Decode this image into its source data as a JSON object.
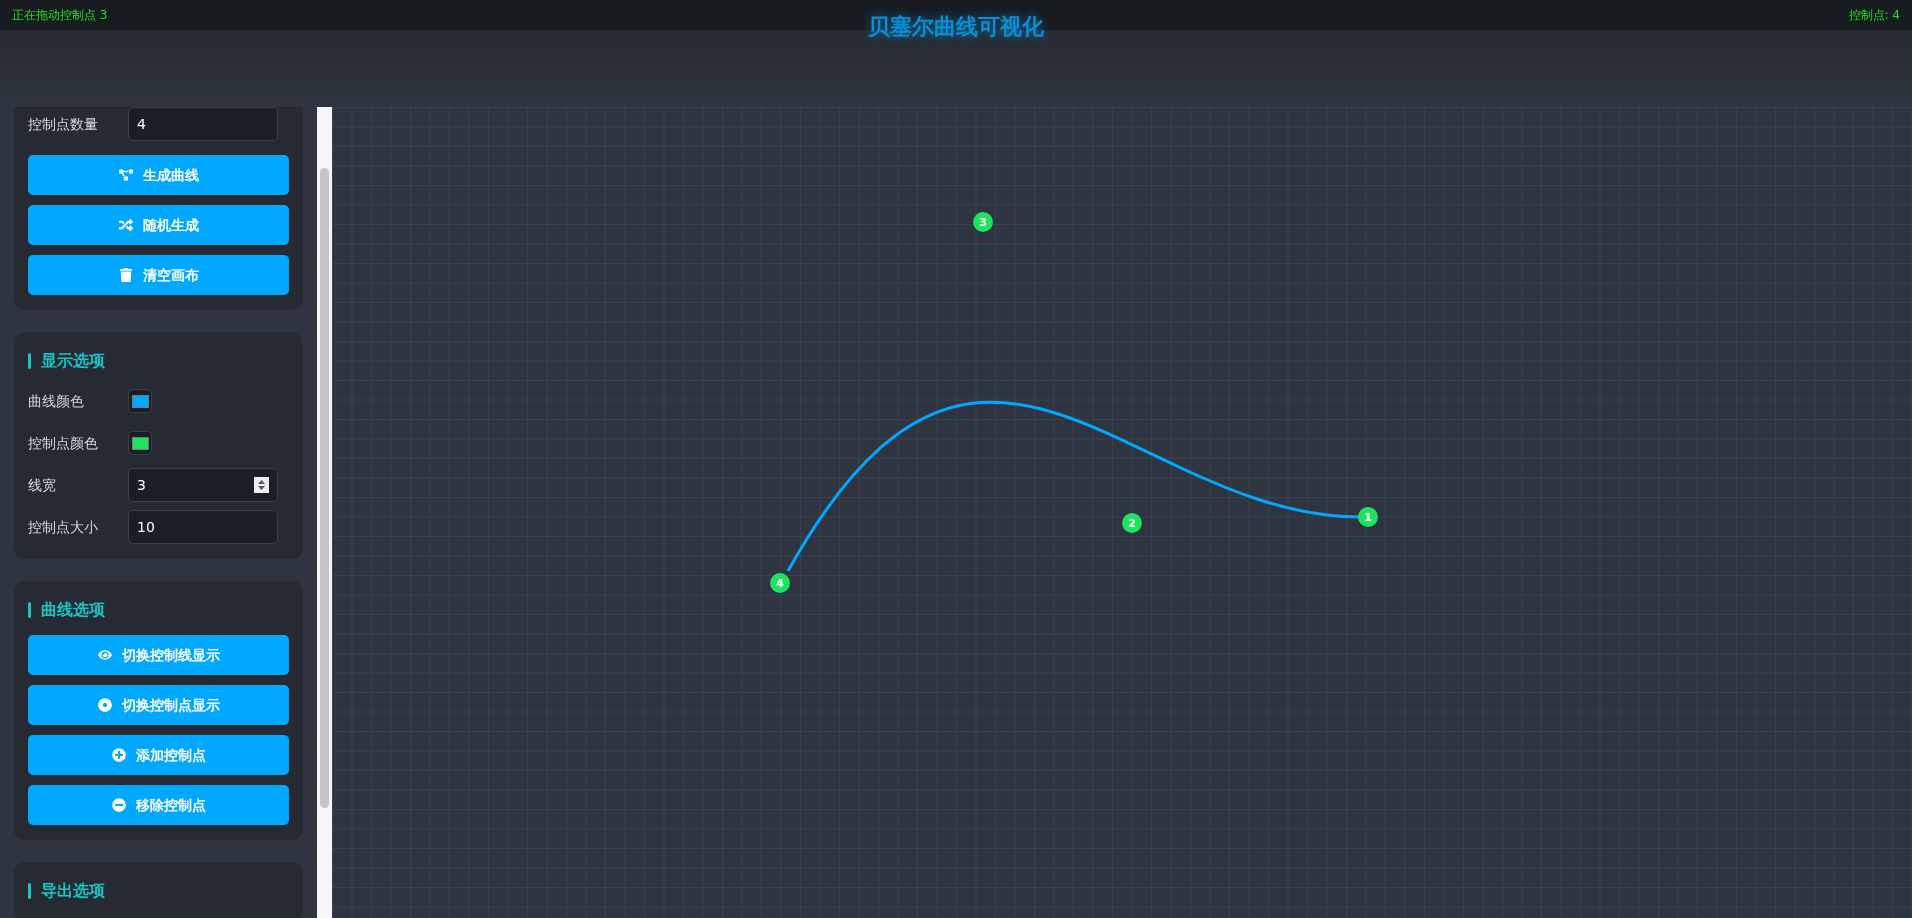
{
  "status_left": "正在拖动控制点 3",
  "title": "贝塞尔曲线可视化",
  "status_right": "控制点: 4",
  "sidebar": [
    {
      "fields": [
        {
          "kind": "number",
          "label": "控制点数量",
          "value": "4"
        }
      ],
      "buttons": [
        {
          "label": "生成曲线"
        },
        {
          "label": "随机生成"
        },
        {
          "label": "清空画布"
        }
      ]
    },
    {
      "heading": "显示选项",
      "fields": [
        {
          "kind": "color",
          "label": "曲线颜色",
          "color": "#00a8ff"
        },
        {
          "kind": "color",
          "label": "控制点颜色",
          "color": "#1ee35e"
        },
        {
          "kind": "spinner",
          "label": "线宽",
          "value": "3"
        },
        {
          "kind": "number",
          "label": "控制点大小",
          "value": "10"
        }
      ]
    },
    {
      "heading": "曲线选项",
      "buttons": [
        {
          "label": "切换控制线显示"
        },
        {
          "label": "切换控制点显示"
        },
        {
          "label": "添加控制点"
        },
        {
          "label": "移除控制点"
        }
      ]
    },
    {
      "heading": "导出选项"
    }
  ],
  "canvas": {
    "points": [
      {
        "label": "3"
      },
      {
        "label": "2"
      },
      {
        "label": "1"
      },
      {
        "label": "4"
      }
    ]
  }
}
